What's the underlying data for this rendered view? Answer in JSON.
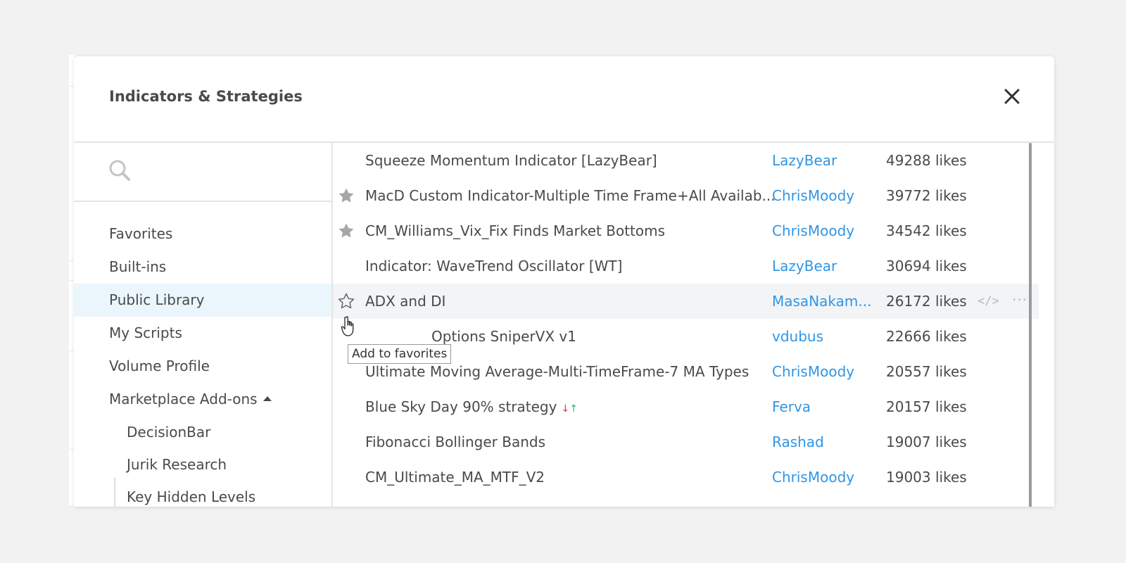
{
  "dialog": {
    "title": "Indicators & Strategies",
    "close_icon": "close-icon"
  },
  "search": {
    "placeholder": "",
    "value": "",
    "icon": "search-icon"
  },
  "sidebar": {
    "items": [
      {
        "label": "Favorites",
        "active": false
      },
      {
        "label": "Built-ins",
        "active": false
      },
      {
        "label": "Public Library",
        "active": true
      },
      {
        "label": "My Scripts",
        "active": false
      },
      {
        "label": "Volume Profile",
        "active": false
      },
      {
        "label": "Marketplace Add-ons",
        "active": false,
        "expanded": true
      }
    ],
    "subitems": [
      {
        "label": "DecisionBar"
      },
      {
        "label": "Jurik Research"
      },
      {
        "label": "Key Hidden Levels"
      }
    ]
  },
  "scripts": [
    {
      "name": "Squeeze Momentum Indicator [LazyBear]",
      "author": "LazyBear",
      "likes": "49288 likes",
      "favorite": "none"
    },
    {
      "name": "MacD Custom Indicator-Multiple Time Frame+All Availab...",
      "author": "ChrisMoody",
      "likes": "39772 likes",
      "favorite": "filled"
    },
    {
      "name": "CM_Williams_Vix_Fix Finds Market Bottoms",
      "author": "ChrisMoody",
      "likes": "34542 likes",
      "favorite": "filled"
    },
    {
      "name": "Indicator: WaveTrend Oscillator [WT]",
      "author": "LazyBear",
      "likes": "30694 likes",
      "favorite": "none"
    },
    {
      "name": "ADX and DI",
      "author": "MasaNakam...",
      "likes": "26172 likes",
      "favorite": "outline",
      "hover": true,
      "source_code_label": "</>",
      "more_label": "···"
    },
    {
      "name": "Options SniperVX v1",
      "author": "vdubus",
      "likes": "22666 likes",
      "favorite": "none"
    },
    {
      "name": "Ultimate Moving Average-Multi-TimeFrame-7 MA Types",
      "author": "ChrisMoody",
      "likes": "20557 likes",
      "favorite": "none"
    },
    {
      "name": "Blue Sky Day 90% strategy",
      "author": "Ferva",
      "likes": "20157 likes",
      "favorite": "none",
      "strategy_arrows": {
        "down": "↓",
        "up": "↑"
      }
    },
    {
      "name": "Fibonacci Bollinger Bands",
      "author": "Rashad",
      "likes": "19007 likes",
      "favorite": "none"
    },
    {
      "name": "CM_Ultimate_MA_MTF_V2",
      "author": "ChrisMoody",
      "likes": "19003 likes",
      "favorite": "none"
    }
  ],
  "tooltip": {
    "text": "Add to favorites"
  },
  "colors": {
    "author_link": "#2f96e6",
    "active_bg": "#eaf6fc",
    "hover_bg": "#f3f4f6",
    "star_filled": "#a6a6a6"
  }
}
